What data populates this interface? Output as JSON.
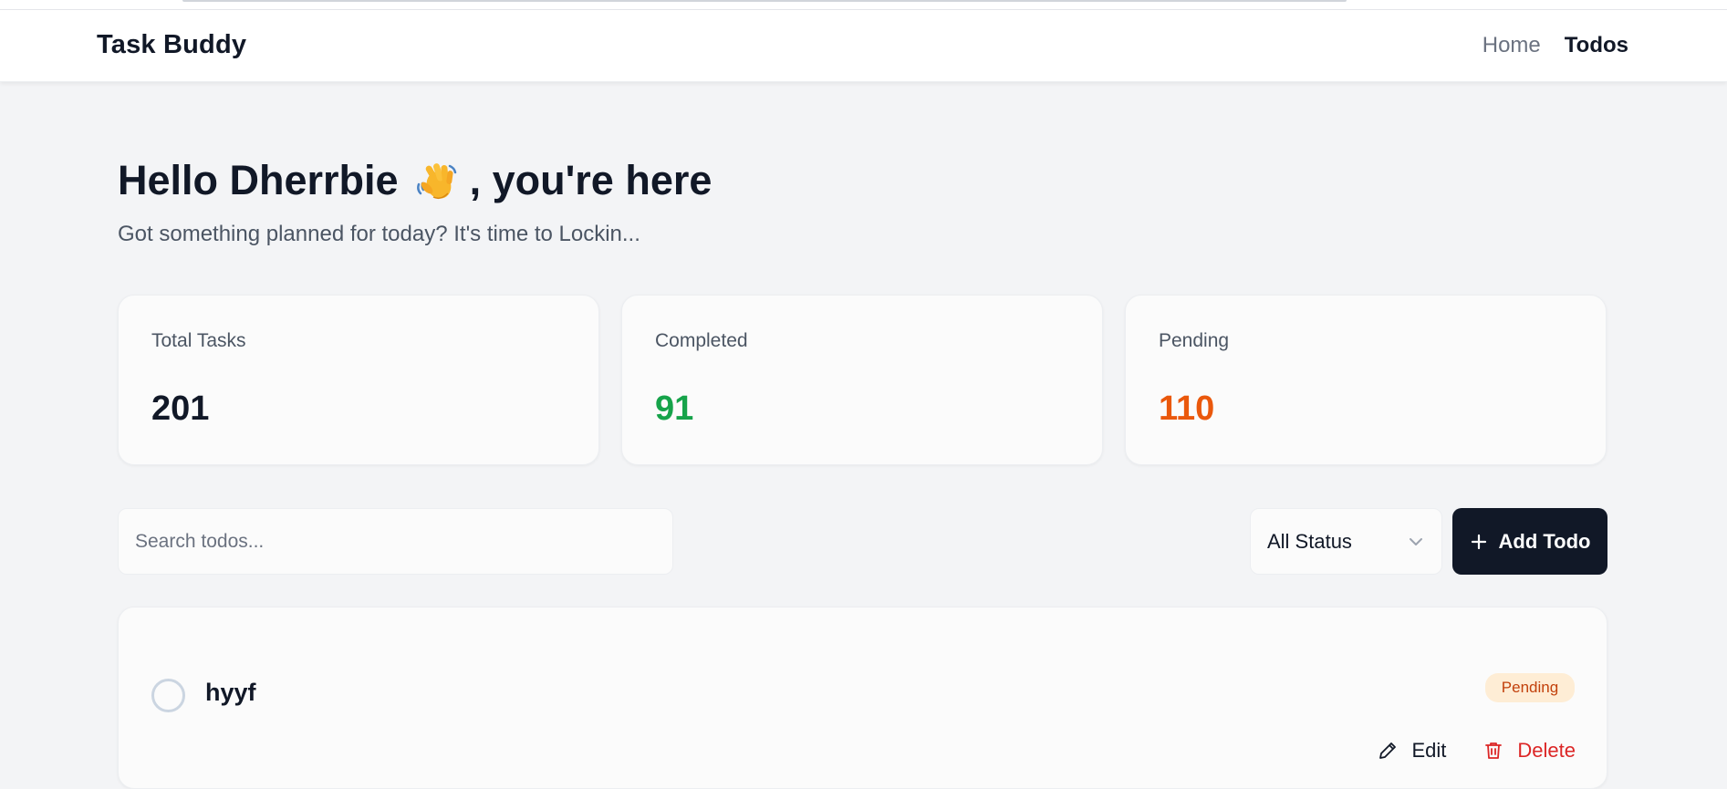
{
  "app": {
    "title": "Task Buddy"
  },
  "nav": {
    "links": [
      {
        "label": "Home",
        "active": false
      },
      {
        "label": "Todos",
        "active": true
      }
    ]
  },
  "hero": {
    "greeting_pre": "Hello Dherrbie",
    "greeting_post": ", you're here",
    "greeting_icon": "waving-hand-icon",
    "subtitle": "Got something planned for today? It's time to Lockin..."
  },
  "stats": [
    {
      "label": "Total Tasks",
      "value": "201",
      "color": "#111827"
    },
    {
      "label": "Completed",
      "value": "91",
      "color": "#16a34a"
    },
    {
      "label": "Pending",
      "value": "110",
      "color": "#ea580c"
    }
  ],
  "toolbar": {
    "search_placeholder": "Search todos...",
    "search_value": "",
    "status_filter": "All Status",
    "add_label": "Add Todo"
  },
  "todos": [
    {
      "title": "hyyf",
      "status": "Pending",
      "completed": false,
      "edit_label": "Edit",
      "delete_label": "Delete"
    }
  ],
  "colors": {
    "accent": "#111827",
    "completed": "#16a34a",
    "pending": "#ea580c",
    "danger": "#dc2626",
    "badge_bg": "#feedd5"
  }
}
